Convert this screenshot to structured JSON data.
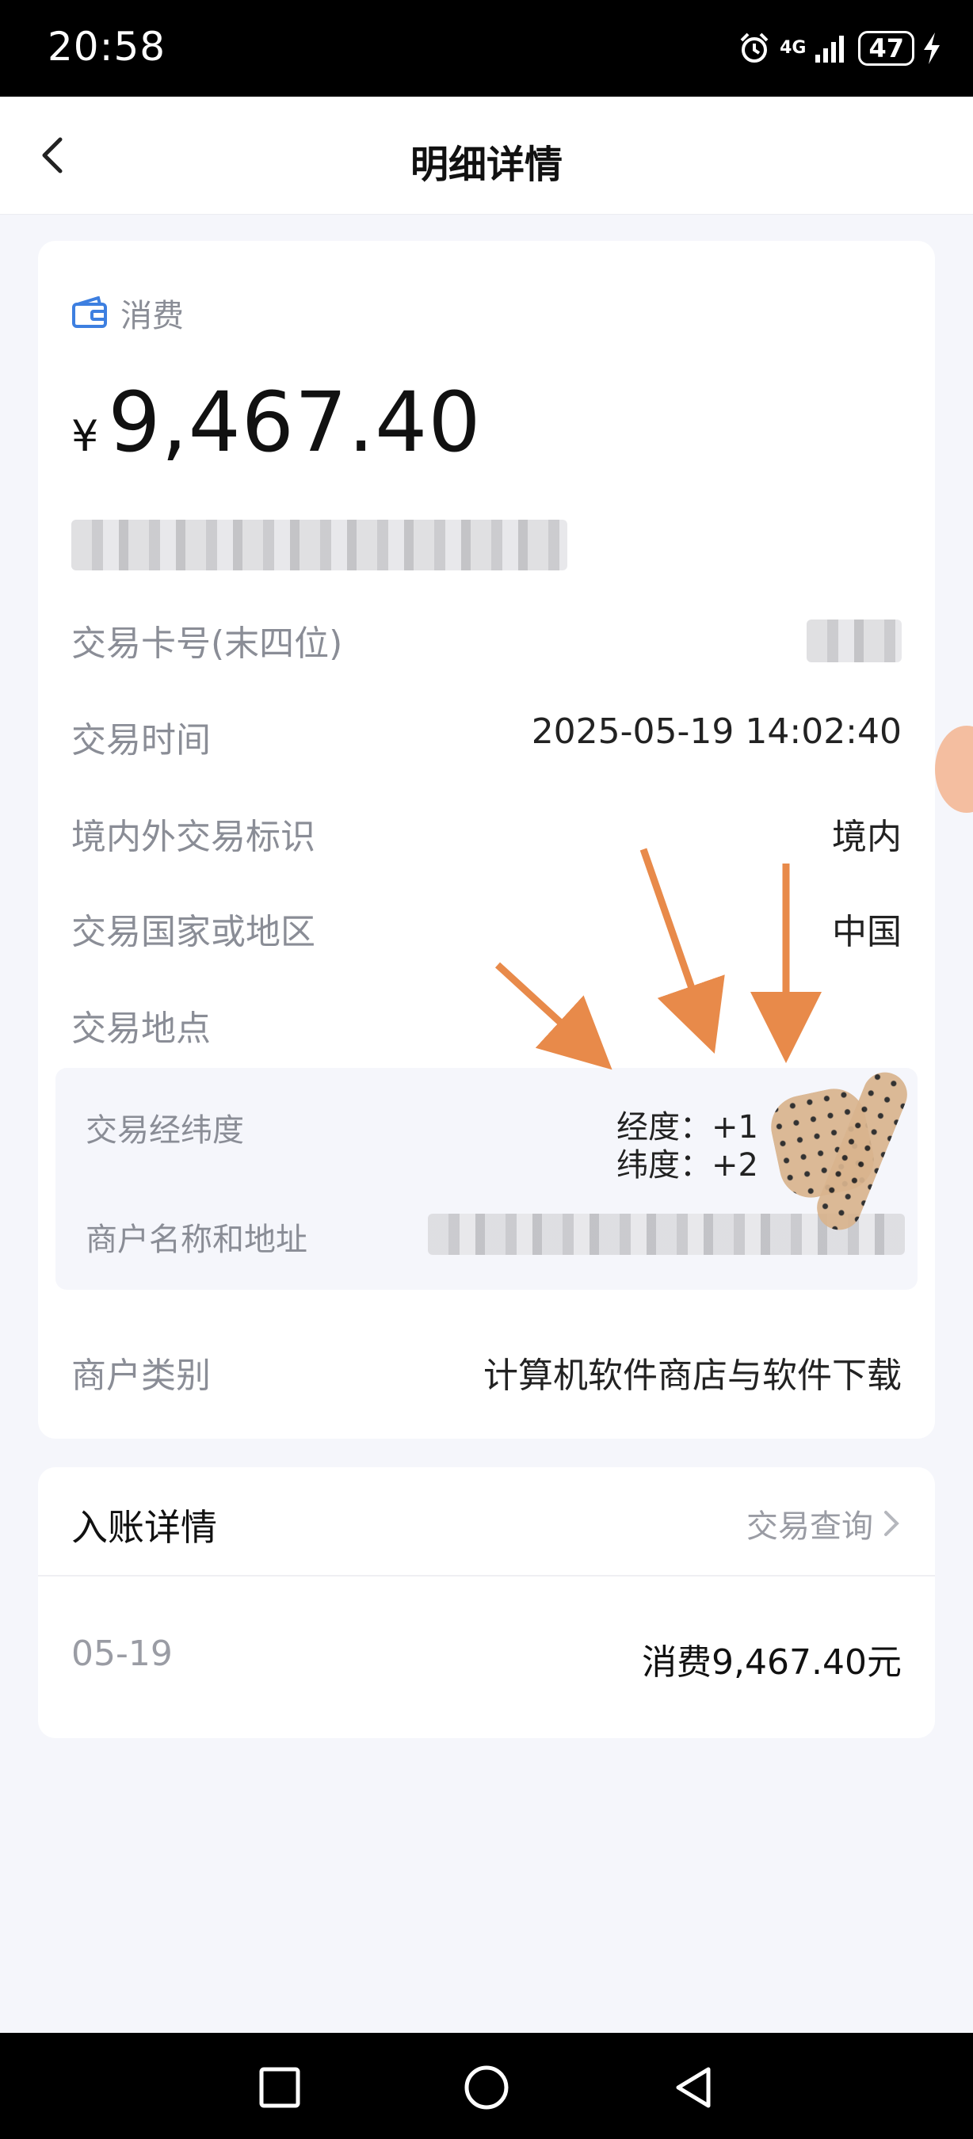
{
  "status_bar": {
    "time": "20:58",
    "network": "4G",
    "battery": "47",
    "icons": [
      "alarm-icon",
      "signal-icon",
      "battery-icon",
      "charging-icon"
    ]
  },
  "header": {
    "title": "明细详情",
    "back_icon": "back-chevron-icon"
  },
  "transaction": {
    "type_icon": "wallet-icon",
    "type": "消费",
    "currency_symbol": "¥",
    "amount": "9,467.40",
    "details": [
      {
        "label": "交易卡号(末四位)",
        "value": ""
      },
      {
        "label": "交易时间",
        "value": "2025-05-19 14:02:40"
      },
      {
        "label": "境内外交易标识",
        "value": "境内"
      },
      {
        "label": "交易国家或地区",
        "value": "中国"
      },
      {
        "label": "交易地点",
        "value": ""
      }
    ],
    "location": {
      "coord_label": "交易经纬度",
      "longitude": "经度：+1",
      "latitude": "纬度：+2",
      "merchant_label": "商户名称和地址"
    },
    "category_label": "商户类别",
    "category_value": "计算机软件商店与软件下载"
  },
  "entry": {
    "title": "入账详情",
    "link_label": "交易查询",
    "date": "05-19",
    "amount_text": "消费9,467.40元"
  },
  "colors": {
    "accent_blue": "#3d7fe0",
    "annotation_orange": "#e88a4a",
    "background": "#f5f6fb"
  }
}
